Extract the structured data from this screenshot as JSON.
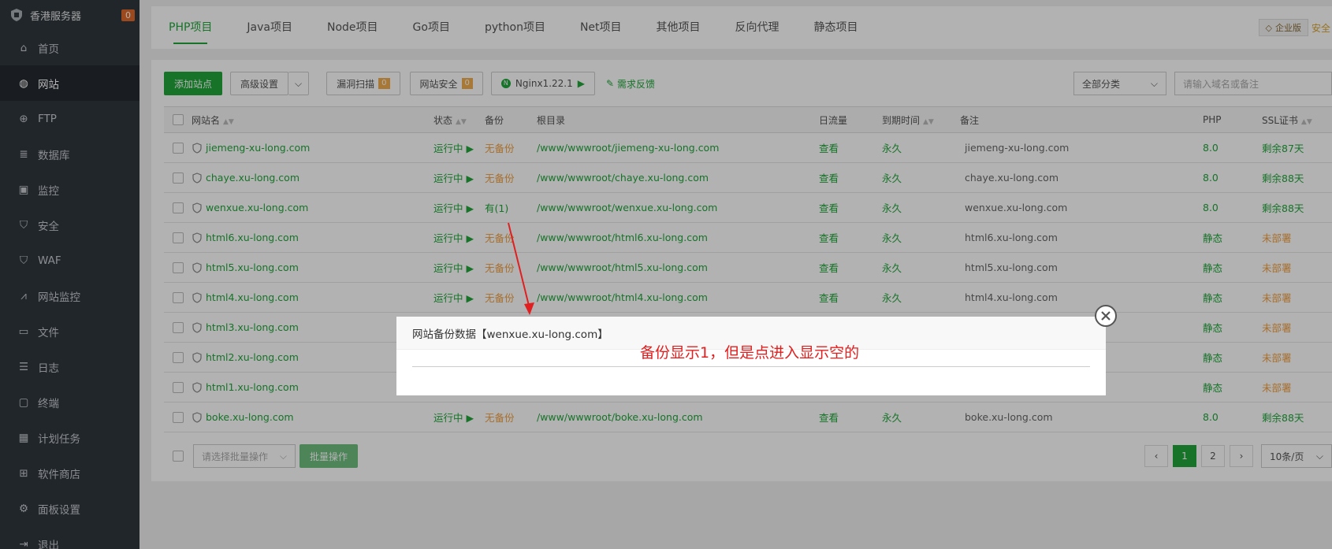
{
  "sidebar": {
    "server_name": "香港服务器",
    "badge": "0",
    "items": [
      {
        "label": "首页",
        "icon": "home-icon"
      },
      {
        "label": "网站",
        "icon": "globe-icon",
        "active": true
      },
      {
        "label": "FTP",
        "icon": "ftp-icon"
      },
      {
        "label": "数据库",
        "icon": "database-icon"
      },
      {
        "label": "监控",
        "icon": "monitor-icon"
      },
      {
        "label": "安全",
        "icon": "shield-icon"
      },
      {
        "label": "WAF",
        "icon": "waf-icon"
      },
      {
        "label": "网站监控",
        "icon": "chart-icon"
      },
      {
        "label": "文件",
        "icon": "folder-icon"
      },
      {
        "label": "日志",
        "icon": "log-icon"
      },
      {
        "label": "终端",
        "icon": "terminal-icon"
      },
      {
        "label": "计划任务",
        "icon": "calendar-icon"
      },
      {
        "label": "软件商店",
        "icon": "grid-icon"
      },
      {
        "label": "面板设置",
        "icon": "gear-icon"
      },
      {
        "label": "退出",
        "icon": "logout-icon"
      }
    ]
  },
  "tabs": [
    "PHP项目",
    "Java项目",
    "Node项目",
    "Go项目",
    "python项目",
    "Net项目",
    "其他项目",
    "反向代理",
    "静态项目"
  ],
  "top_right": {
    "enterprise": "企业版",
    "safe": "安全"
  },
  "toolbar": {
    "add_site": "添加站点",
    "advanced": "高级设置",
    "vuln_scan": "漏洞扫描",
    "vuln_count": "0",
    "site_security": "网站安全",
    "security_count": "0",
    "nginx": "Nginx1.22.1",
    "feedback": "需求反馈",
    "category": "全部分类",
    "search_placeholder": "请输入域名或备注"
  },
  "table": {
    "headers": [
      "网站名",
      "状态",
      "备份",
      "根目录",
      "日流量",
      "到期时间",
      "备注",
      "PHP",
      "SSL证书"
    ],
    "rows": [
      {
        "name": "jiemeng-xu-long.com",
        "status": "运行中",
        "backup": "无备份",
        "root": "/www/wwwroot/jiemeng-xu-long.com",
        "traffic": "查看",
        "expire": "永久",
        "note": "jiemeng-xu-long.com",
        "php": "8.0",
        "ssl": "剩余87天"
      },
      {
        "name": "chaye.xu-long.com",
        "status": "运行中",
        "backup": "无备份",
        "root": "/www/wwwroot/chaye.xu-long.com",
        "traffic": "查看",
        "expire": "永久",
        "note": "chaye.xu-long.com",
        "php": "8.0",
        "ssl": "剩余88天"
      },
      {
        "name": "wenxue.xu-long.com",
        "status": "运行中",
        "backup": "有(1)",
        "root": "/www/wwwroot/wenxue.xu-long.com",
        "traffic": "查看",
        "expire": "永久",
        "note": "wenxue.xu-long.com",
        "php": "8.0",
        "ssl": "剩余88天"
      },
      {
        "name": "html6.xu-long.com",
        "status": "运行中",
        "backup": "无备份",
        "root": "/www/wwwroot/html6.xu-long.com",
        "traffic": "查看",
        "expire": "永久",
        "note": "html6.xu-long.com",
        "php": "静态",
        "ssl": "未部署"
      },
      {
        "name": "html5.xu-long.com",
        "status": "运行中",
        "backup": "无备份",
        "root": "/www/wwwroot/html5.xu-long.com",
        "traffic": "查看",
        "expire": "永久",
        "note": "html5.xu-long.com",
        "php": "静态",
        "ssl": "未部署"
      },
      {
        "name": "html4.xu-long.com",
        "status": "运行中",
        "backup": "无备份",
        "root": "/www/wwwroot/html4.xu-long.com",
        "traffic": "查看",
        "expire": "永久",
        "note": "html4.xu-long.com",
        "php": "静态",
        "ssl": "未部署"
      },
      {
        "name": "html3.xu-long.com",
        "status": "",
        "backup": "",
        "root": "",
        "traffic": "",
        "expire": "",
        "note": "",
        "php": "静态",
        "ssl": "未部署"
      },
      {
        "name": "html2.xu-long.com",
        "status": "",
        "backup": "",
        "root": "",
        "traffic": "",
        "expire": "",
        "note": "",
        "php": "静态",
        "ssl": "未部署"
      },
      {
        "name": "html1.xu-long.com",
        "status": "",
        "backup": "",
        "root": "",
        "traffic": "",
        "expire": "",
        "note": "",
        "php": "静态",
        "ssl": "未部署"
      },
      {
        "name": "boke.xu-long.com",
        "status": "运行中",
        "backup": "无备份",
        "root": "/www/wwwroot/boke.xu-long.com",
        "traffic": "查看",
        "expire": "永久",
        "note": "boke.xu-long.com",
        "php": "8.0",
        "ssl": "剩余88天"
      }
    ]
  },
  "footer": {
    "batch_placeholder": "请选择批量操作",
    "batch_button": "批量操作",
    "pages": [
      "1",
      "2"
    ],
    "page_size": "10条/页"
  },
  "modal": {
    "title": "网站备份数据【wenxue.xu-long.com】",
    "annotation": "备份显示1，但是点进入显示空的"
  }
}
